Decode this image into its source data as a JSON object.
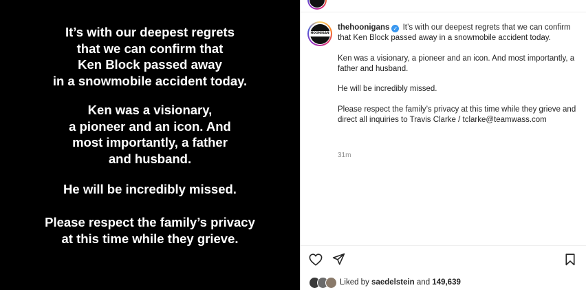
{
  "post_image": {
    "paragraphs": [
      [
        "It’s with our deepest regrets",
        "that we can confirm that",
        "Ken Block passed away",
        "in a snowmobile accident today."
      ],
      [
        "Ken was a visionary,",
        "a pioneer and an icon. And",
        "most importantly, a father",
        "and husband."
      ],
      [
        "He will be incredibly missed."
      ],
      [
        "Please respect the family’s privacy",
        "at this time while they grieve."
      ]
    ]
  },
  "post": {
    "username": "thehoonigans",
    "avatar_text": "HOONIGAN",
    "verified_glyph": "✓",
    "caption": [
      "It’s with our deepest regrets that we can confirm that Ken Block passed away in a snowmobile accident today.",
      "Ken was a visionary, a pioneer and an icon. And most importantly, a father and husband.",
      "He will be incredibly missed.",
      "Please respect the family’s privacy at this time while they grieve and direct all inquiries to Travis Clarke / tclarke@teamwass.com"
    ],
    "timestamp": "31m"
  },
  "likes": {
    "prefix": "Liked by",
    "user": "saedelstein",
    "conjunction": "and",
    "count": "149,639"
  },
  "colors": {
    "image_bg": "#000000",
    "verified": "#3897f0",
    "text": "#262626",
    "muted": "#8e8e8e"
  },
  "icons": {
    "like": "heart-icon",
    "share": "paper-plane-icon",
    "save": "bookmark-icon",
    "verified": "verified-badge-icon"
  }
}
